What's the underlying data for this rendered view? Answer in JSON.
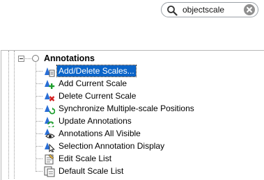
{
  "search": {
    "value": "objectscale",
    "placeholder": ""
  },
  "tree": {
    "root": {
      "label": "Annotations",
      "expanded": true
    },
    "items": [
      {
        "label": "Add/Delete Scales...",
        "icon": "scale-list-icon",
        "selected": true
      },
      {
        "label": "Add Current Scale",
        "icon": "add-scale-icon",
        "selected": false
      },
      {
        "label": "Delete Current Scale",
        "icon": "delete-scale-icon",
        "selected": false
      },
      {
        "label": "Synchronize Multiple-scale Positions",
        "icon": "sync-scale-icon",
        "selected": false
      },
      {
        "label": "Update Annotations",
        "icon": "update-annotations-icon",
        "selected": false
      },
      {
        "label": "Annotations All Visible",
        "icon": "visible-eye-icon",
        "selected": false
      },
      {
        "label": "Selection Annotation Display",
        "icon": "selection-cursor-icon",
        "selected": false
      },
      {
        "label": "Edit Scale List",
        "icon": "edit-list-icon",
        "selected": false
      },
      {
        "label": "Default Scale List",
        "icon": "default-list-icon",
        "selected": false
      }
    ]
  },
  "colors": {
    "selection": "#0a64c8",
    "scale_blue": "#2b6fd6",
    "add_green": "#1e9e2e",
    "delete_red": "#d42020"
  }
}
